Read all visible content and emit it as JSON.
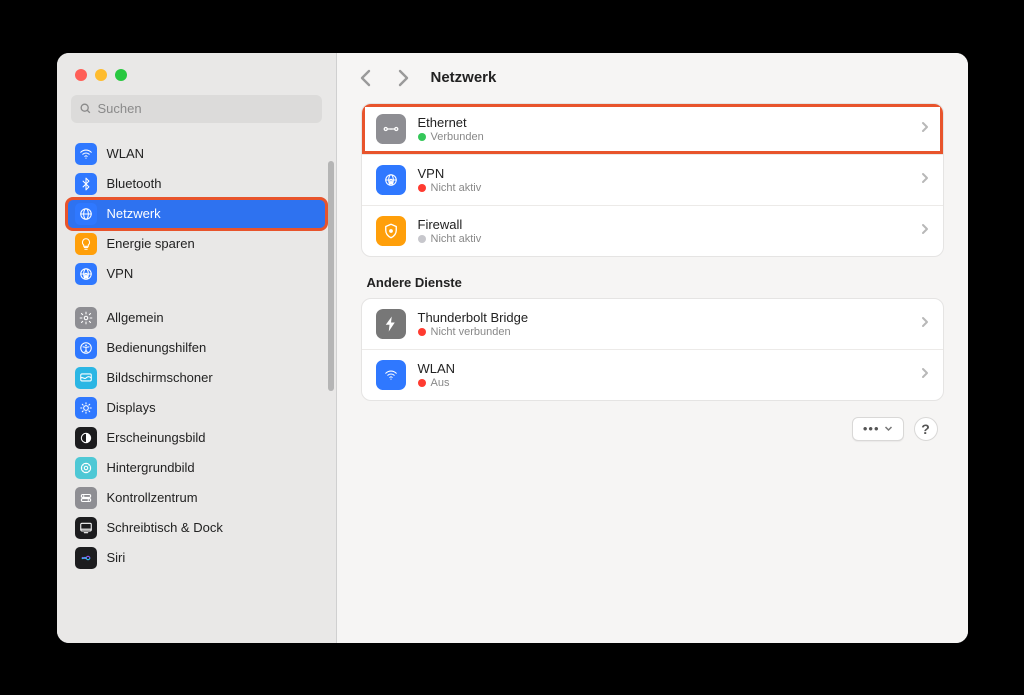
{
  "search": {
    "placeholder": "Suchen"
  },
  "sidebar": {
    "group1": [
      {
        "label": "WLAN",
        "icon": "wifi-icon",
        "iconClass": "ic-blue"
      },
      {
        "label": "Bluetooth",
        "icon": "bluetooth-icon",
        "iconClass": "ic-blue"
      },
      {
        "label": "Netzwerk",
        "icon": "globe-icon",
        "iconClass": "ic-blue",
        "selected": true,
        "highlighted": true
      },
      {
        "label": "Energie sparen",
        "icon": "bulb-icon",
        "iconClass": "ic-orange"
      },
      {
        "label": "VPN",
        "icon": "vpn-icon",
        "iconClass": "ic-blue"
      }
    ],
    "group2": [
      {
        "label": "Allgemein",
        "icon": "gear-icon",
        "iconClass": "ic-gray"
      },
      {
        "label": "Bedienungshilfen",
        "icon": "accessibility-icon",
        "iconClass": "ic-blue"
      },
      {
        "label": "Bildschirmschoner",
        "icon": "screensaver-icon",
        "iconClass": "ic-cyan"
      },
      {
        "label": "Displays",
        "icon": "displays-icon",
        "iconClass": "ic-blue"
      },
      {
        "label": "Erscheinungsbild",
        "icon": "appearance-icon",
        "iconClass": "ic-dark"
      },
      {
        "label": "Hintergrundbild",
        "icon": "wallpaper-icon",
        "iconClass": "ic-teal"
      },
      {
        "label": "Kontrollzentrum",
        "icon": "control-center-icon",
        "iconClass": "ic-gray"
      },
      {
        "label": "Schreibtisch & Dock",
        "icon": "dock-icon",
        "iconClass": "ic-dark"
      },
      {
        "label": "Siri",
        "icon": "siri-icon",
        "iconClass": "ic-dark"
      }
    ]
  },
  "header": {
    "title": "Netzwerk"
  },
  "main": {
    "primary": [
      {
        "title": "Ethernet",
        "status": "Verbunden",
        "statusColor": "green",
        "icon": "ethernet-icon",
        "iconClass": "ri-gray",
        "highlighted": true
      },
      {
        "title": "VPN",
        "status": "Nicht aktiv",
        "statusColor": "red",
        "icon": "vpn-icon",
        "iconClass": "ri-blue"
      },
      {
        "title": "Firewall",
        "status": "Nicht aktiv",
        "statusColor": "gray",
        "icon": "firewall-icon",
        "iconClass": "ri-orange"
      }
    ],
    "other_title": "Andere Dienste",
    "other": [
      {
        "title": "Thunderbolt Bridge",
        "status": "Nicht verbunden",
        "statusColor": "red",
        "icon": "thunderbolt-icon",
        "iconClass": "ri-darkgray"
      },
      {
        "title": "WLAN",
        "status": "Aus",
        "statusColor": "red",
        "icon": "wifi-icon",
        "iconClass": "ri-blue"
      }
    ]
  },
  "footer": {
    "more": "•••",
    "help": "?"
  }
}
